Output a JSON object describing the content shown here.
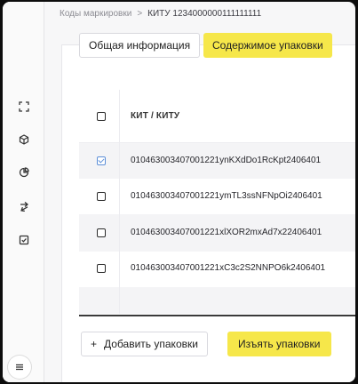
{
  "breadcrumb": {
    "parent": "Коды маркировки",
    "separator": ">",
    "current": "КИТУ 1234000000111111111"
  },
  "tabs": {
    "info_label": "Общая информация",
    "content_label": "Содержимое упаковки",
    "active": "content"
  },
  "sidebar": {
    "icons": [
      "expand-icon",
      "box-icon",
      "pie-chart-icon",
      "transfer-icon",
      "checklist-icon"
    ],
    "menu_icon": "hamburger-menu-icon"
  },
  "table": {
    "header": "КИТ / КИТУ",
    "rows": [
      {
        "code": "010463003407001221ynKXdDo1RcKpt2406401",
        "checked": true
      },
      {
        "code": "010463003407001221ymTL3ssNFNpOi2406401",
        "checked": false
      },
      {
        "code": "010463003407001221xlXOR2mxAd7x22406401",
        "checked": false
      },
      {
        "code": "010463003407001221xC3c2S2NNPO6k2406401",
        "checked": false
      }
    ]
  },
  "actions": {
    "add_label": "Добавить упаковки",
    "add_prefix": "+",
    "remove_label": "Изъять упаковки"
  },
  "colors": {
    "accent": "#f6e74a",
    "checkbox_checked": "#5d8fd8"
  }
}
